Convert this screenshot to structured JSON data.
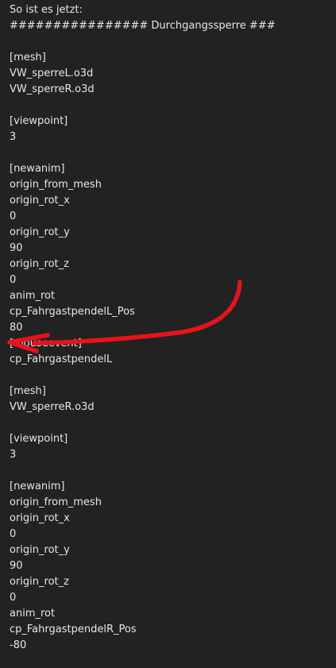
{
  "post": {
    "intro": "So ist es jetzt:",
    "header": "################ Durchgangssperre ###",
    "mesh1_tag": "[mesh]",
    "mesh1_l": "VW_sperreL.o3d",
    "mesh1_r": "VW_sperreR.o3d",
    "viewpoint1_tag": "[viewpoint]",
    "viewpoint1_val": "3",
    "newanim1_tag": "[newanim]",
    "newanim1_origin_from_mesh": "origin_from_mesh",
    "newanim1_rot_x_key": "origin_rot_x",
    "newanim1_rot_x_val": "0",
    "newanim1_rot_y_key": "origin_rot_y",
    "newanim1_rot_y_val": "90",
    "newanim1_rot_z_key": "origin_rot_z",
    "newanim1_rot_z_val": "0",
    "newanim1_anim_rot": "anim_rot",
    "newanim1_var": "cp_FahrgastpendelL_Pos",
    "newanim1_val": "80",
    "mouseevent_tag": "[mouseevent]",
    "mouseevent_val": "cp_FahrgastpendelL",
    "mesh2_tag": "[mesh]",
    "mesh2_r": "VW_sperreR.o3d",
    "viewpoint2_tag": "[viewpoint]",
    "viewpoint2_val": "3",
    "newanim2_tag": "[newanim]",
    "newanim2_origin_from_mesh": "origin_from_mesh",
    "newanim2_rot_x_key": "origin_rot_x",
    "newanim2_rot_x_val": "0",
    "newanim2_rot_y_key": "origin_rot_y",
    "newanim2_rot_y_val": "90",
    "newanim2_rot_z_key": "origin_rot_z",
    "newanim2_rot_z_val": "0",
    "newanim2_anim_rot": "anim_rot",
    "newanim2_var": "cp_FahrgastpendelR_Pos",
    "newanim2_val": "-80"
  },
  "colors": {
    "background": "#222222",
    "text": "#e6e6e6",
    "annotation_arrow": "#e8121a"
  }
}
